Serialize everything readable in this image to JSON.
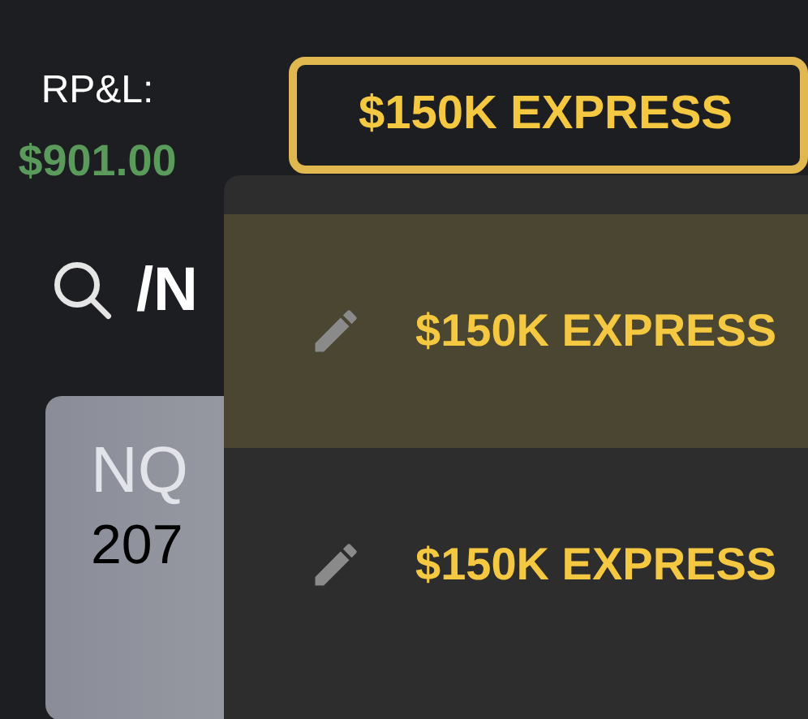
{
  "rpl": {
    "label": "RP&L:",
    "value": "$901.00"
  },
  "account_button": {
    "label": "$150K EXPRESS"
  },
  "search": {
    "value": "/N"
  },
  "card": {
    "symbol": "NQ",
    "value": "207"
  },
  "account_menu": [
    {
      "label": "$150K EXPRESS",
      "selected": true
    },
    {
      "label": "$150K EXPRESS",
      "selected": false
    }
  ]
}
